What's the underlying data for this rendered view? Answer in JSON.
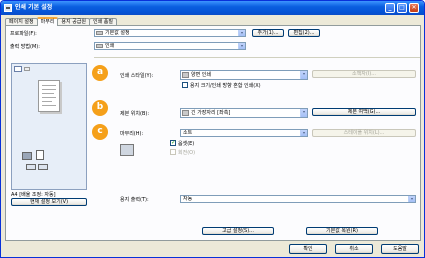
{
  "window": {
    "title": "인쇄 기본 설정",
    "minimize": "_",
    "maximize": "□",
    "close": "✕"
  },
  "tabs": [
    "페이지 설정",
    "마무리",
    "용지 공급원",
    "인쇄 품질"
  ],
  "profile": {
    "label": "프로파일(F):",
    "value": "기본값 설정",
    "add": "추가(1)...",
    "edit": "편집(2)..."
  },
  "output": {
    "label": "출력 방법(M):",
    "value": "인쇄"
  },
  "print_style": {
    "label": "인쇄 스타일(Y):",
    "value": "양면 인쇄",
    "layout_btn": "소책자(I)...",
    "mix_checkbox": "용지 크기/인쇄 방향 혼합 인쇄(X)"
  },
  "binding": {
    "label": "제본 위치(B):",
    "value": "긴 가장자리 [좌측]",
    "margin_btn": "제본 여백(G)..."
  },
  "finishing": {
    "label": "마무리(H):",
    "value": "소트",
    "staple_btn": "스테이플 위치(L)...",
    "offset_checkbox": "옵셋(E)",
    "rotate_checkbox": "회전(O)"
  },
  "preview": {
    "status": "A4 [배율 조정: 자동]",
    "view_btn": "현재 설정 보기(V)"
  },
  "paper_output": {
    "label": "용지 출력(T):",
    "value": "자동"
  },
  "advanced_btn": "고급 설정(S)...",
  "restore_btn": "기본값 복원(R)",
  "footer": {
    "ok": "확인",
    "cancel": "취소",
    "help": "도움말"
  },
  "badges": [
    "a",
    "b",
    "c"
  ],
  "colors": {
    "badge": "#f5a01a",
    "titlebar": "#0a5fe0",
    "tab_accent": "#f6a83a"
  }
}
